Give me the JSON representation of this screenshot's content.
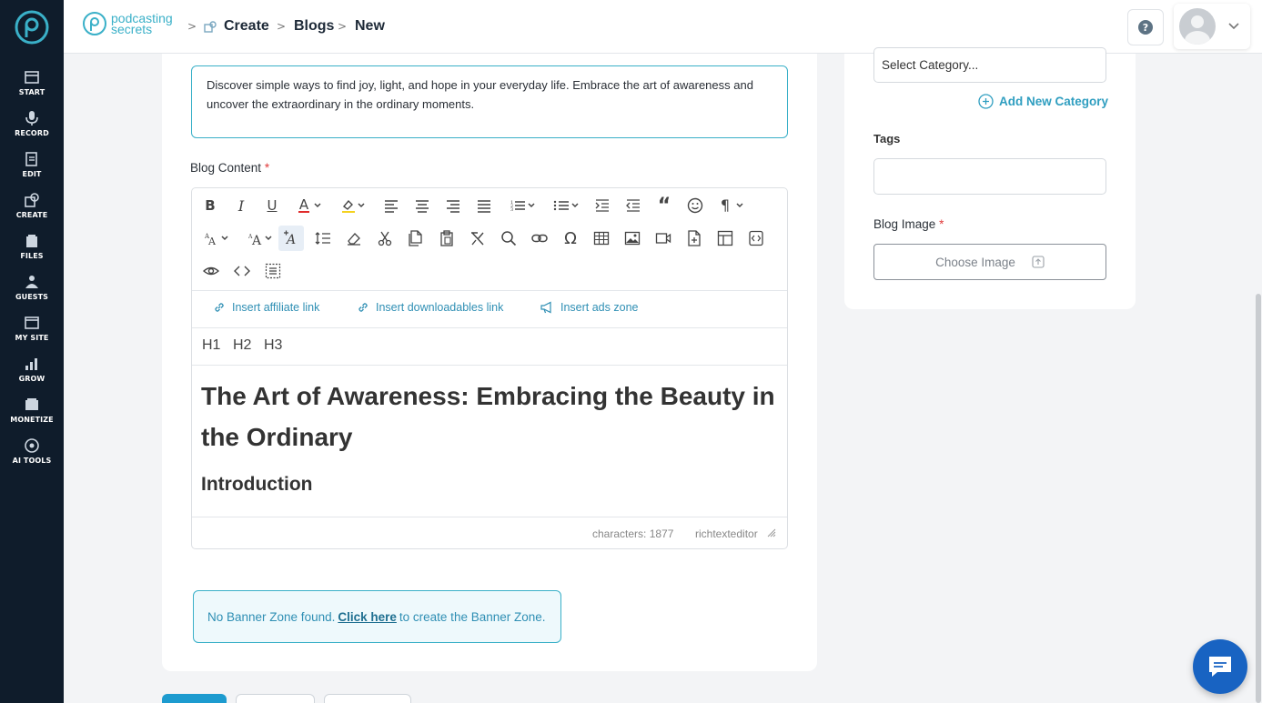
{
  "sidebar": {
    "items": [
      {
        "label": "START",
        "icon": "start-icon"
      },
      {
        "label": "RECORD",
        "icon": "microphone-icon"
      },
      {
        "label": "EDIT",
        "icon": "edit-icon"
      },
      {
        "label": "CREATE",
        "icon": "create-icon"
      },
      {
        "label": "FILES",
        "icon": "files-icon"
      },
      {
        "label": "GUESTS",
        "icon": "guests-icon"
      },
      {
        "label": "MY SITE",
        "icon": "site-icon"
      },
      {
        "label": "GROW",
        "icon": "chart-icon"
      },
      {
        "label": "MONETIZE",
        "icon": "monetize-icon"
      },
      {
        "label": "AI TOOLS",
        "icon": "ai-tools-icon"
      }
    ]
  },
  "header": {
    "brand_line1": "podcasting",
    "brand_line2": "secrets",
    "breadcrumb": [
      "Create",
      "Blogs",
      "New"
    ]
  },
  "main": {
    "description": "Discover simple ways to find joy, light, and hope in your everyday life. Embrace the art of awareness and uncover the extraordinary in the ordinary moments.",
    "blog_content_label": "Blog Content",
    "required_mark": "*",
    "insert_links": [
      "Insert affiliate link",
      "Insert downloadables link",
      "Insert ads zone"
    ],
    "heading_buttons": [
      "H1",
      "H2",
      "H3"
    ],
    "content_title": "The Art of Awareness: Embracing the Beauty in the Ordinary",
    "content_subtitle": "Introduction",
    "status_chars": "characters: 1877",
    "status_editor": "richtexteditor",
    "banner_text_before": "No Banner Zone found.",
    "banner_link": "Click here",
    "banner_text_after": "to create the Banner Zone."
  },
  "side": {
    "category_placeholder": "Select Category...",
    "add_category": "Add New Category",
    "tags_label": "Tags",
    "tags_value": "",
    "blog_image_label": "Blog Image",
    "choose_image": "Choose Image"
  },
  "colors": {
    "accent": "#3ab0c8",
    "sidebar_bg": "#0f1c2b",
    "chat": "#1863c2"
  }
}
